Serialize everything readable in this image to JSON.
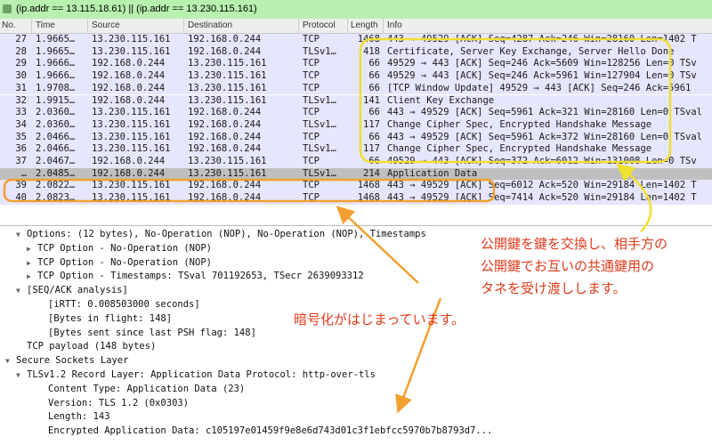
{
  "filter": {
    "text": "(ip.addr == 13.115.18.61) || (ip.addr == 13.230.115.161)"
  },
  "columns": [
    "No.",
    "Time",
    "Source",
    "Destination",
    "Protocol",
    "Length",
    "Info"
  ],
  "packets": [
    {
      "no": "27",
      "time": "1.9665…",
      "src": "13.230.115.161",
      "dst": "192.168.0.244",
      "proto": "TCP",
      "len": "1468",
      "info": "443 → 49529 [ACK] Seq=4287 Ack=246 Win=28160 Len=1402 T",
      "kind": "tcp"
    },
    {
      "no": "28",
      "time": "1.9665…",
      "src": "13.230.115.161",
      "dst": "192.168.0.244",
      "proto": "TLSv1…",
      "len": "418",
      "info": "Certificate, Server Key Exchange, Server Hello Done",
      "kind": "tls"
    },
    {
      "no": "29",
      "time": "1.9666…",
      "src": "192.168.0.244",
      "dst": "13.230.115.161",
      "proto": "TCP",
      "len": "66",
      "info": "49529 → 443 [ACK] Seq=246 Ack=5609 Win=128256 Len=0 TSv",
      "kind": "tcp"
    },
    {
      "no": "30",
      "time": "1.9666…",
      "src": "192.168.0.244",
      "dst": "13.230.115.161",
      "proto": "TCP",
      "len": "66",
      "info": "49529 → 443 [ACK] Seq=246 Ack=5961 Win=127904 Len=0 TSv",
      "kind": "tcp"
    },
    {
      "no": "31",
      "time": "1.9708…",
      "src": "192.168.0.244",
      "dst": "13.230.115.161",
      "proto": "TCP",
      "len": "66",
      "info": "[TCP Window Update] 49529 → 443 [ACK] Seq=246 Ack=5961",
      "kind": "tcp"
    },
    {
      "no": "32",
      "time": "1.9915…",
      "src": "192.168.0.244",
      "dst": "13.230.115.161",
      "proto": "TLSv1…",
      "len": "141",
      "info": "Client Key Exchange",
      "kind": "tls"
    },
    {
      "no": "33",
      "time": "2.0360…",
      "src": "13.230.115.161",
      "dst": "192.168.0.244",
      "proto": "TCP",
      "len": "66",
      "info": "443 → 49529 [ACK] Seq=5961 Ack=321 Win=28160 Len=0 TSval",
      "kind": "tcp"
    },
    {
      "no": "34",
      "time": "2.0360…",
      "src": "13.230.115.161",
      "dst": "192.168.0.244",
      "proto": "TLSv1…",
      "len": "117",
      "info": "Change Cipher Spec, Encrypted Handshake Message",
      "kind": "tls"
    },
    {
      "no": "35",
      "time": "2.0466…",
      "src": "13.230.115.161",
      "dst": "192.168.0.244",
      "proto": "TCP",
      "len": "66",
      "info": "443 → 49529 [ACK] Seq=5961 Ack=372 Win=28160 Len=0 TSval",
      "kind": "tcp"
    },
    {
      "no": "36",
      "time": "2.0466…",
      "src": "13.230.115.161",
      "dst": "192.168.0.244",
      "proto": "TLSv1…",
      "len": "117",
      "info": "Change Cipher Spec, Encrypted Handshake Message",
      "kind": "tls"
    },
    {
      "no": "37",
      "time": "2.0467…",
      "src": "192.168.0.244",
      "dst": "13.230.115.161",
      "proto": "TCP",
      "len": "66",
      "info": "49529 → 443 [ACK] Seq=372 Ack=6012 Win=131008 Len=0 TSv",
      "kind": "tcp"
    },
    {
      "no": "…",
      "time": "2.0485…",
      "src": "192.168.0.244",
      "dst": "13.230.115.161",
      "proto": "TLSv1…",
      "len": "214",
      "info": "Application Data",
      "kind": "sel"
    },
    {
      "no": "39",
      "time": "2.0822…",
      "src": "13.230.115.161",
      "dst": "192.168.0.244",
      "proto": "TCP",
      "len": "1468",
      "info": "443 → 49529 [ACK] Seq=6012 Ack=520 Win=29184 Len=1402 T",
      "kind": "tcp"
    },
    {
      "no": "40",
      "time": "2.0823…",
      "src": "13.230.115.161",
      "dst": "192.168.0.244",
      "proto": "TCP",
      "len": "1468",
      "info": "443 → 49529 [ACK] Seq=7414 Ack=520 Win=29184 Len=1402 T",
      "kind": "tcp"
    }
  ],
  "details": [
    {
      "indent": 1,
      "arrow": "down",
      "text": "Options: (12 bytes), No-Operation (NOP), No-Operation (NOP), Timestamps"
    },
    {
      "indent": 2,
      "arrow": "right",
      "text": "TCP Option - No-Operation (NOP)"
    },
    {
      "indent": 2,
      "arrow": "right",
      "text": "TCP Option - No-Operation (NOP)"
    },
    {
      "indent": 2,
      "arrow": "right",
      "text": "TCP Option - Timestamps: TSval 701192653, TSecr 2639093312"
    },
    {
      "indent": 1,
      "arrow": "down",
      "text": "[SEQ/ACK analysis]"
    },
    {
      "indent": 3,
      "arrow": "",
      "text": "[iRTT: 0.008503000 seconds]"
    },
    {
      "indent": 3,
      "arrow": "",
      "text": "[Bytes in flight: 148]"
    },
    {
      "indent": 3,
      "arrow": "",
      "text": "[Bytes sent since last PSH flag: 148]"
    },
    {
      "indent": 1,
      "arrow": "",
      "text": "TCP payload (148 bytes)"
    },
    {
      "indent": 0,
      "arrow": "down",
      "text": "Secure Sockets Layer"
    },
    {
      "indent": 1,
      "arrow": "down",
      "text": "TLSv1.2 Record Layer: Application Data Protocol: http-over-tls"
    },
    {
      "indent": 3,
      "arrow": "",
      "text": "Content Type: Application Data (23)"
    },
    {
      "indent": 3,
      "arrow": "",
      "text": "Version: TLS 1.2 (0x0303)"
    },
    {
      "indent": 3,
      "arrow": "",
      "text": "Length: 143"
    },
    {
      "indent": 3,
      "arrow": "",
      "text": "Encrypted Application Data: c105197e01459f9e8e6d743d01c3f1ebfcc5970b7b8793d7..."
    }
  ],
  "annotations": {
    "key_exchange": [
      "公開鍵を鍵を交換し、相手方の",
      "公開鍵でお互いの共通鍵用の",
      "タネを受け渡しします。"
    ],
    "encryption": "暗号化がはじまっています。"
  },
  "colors": {
    "annotation": "#e03a1a",
    "yellow_box": "#f0e030",
    "orange_box": "#f2a030",
    "filter_bg": "#b8f0b0"
  }
}
